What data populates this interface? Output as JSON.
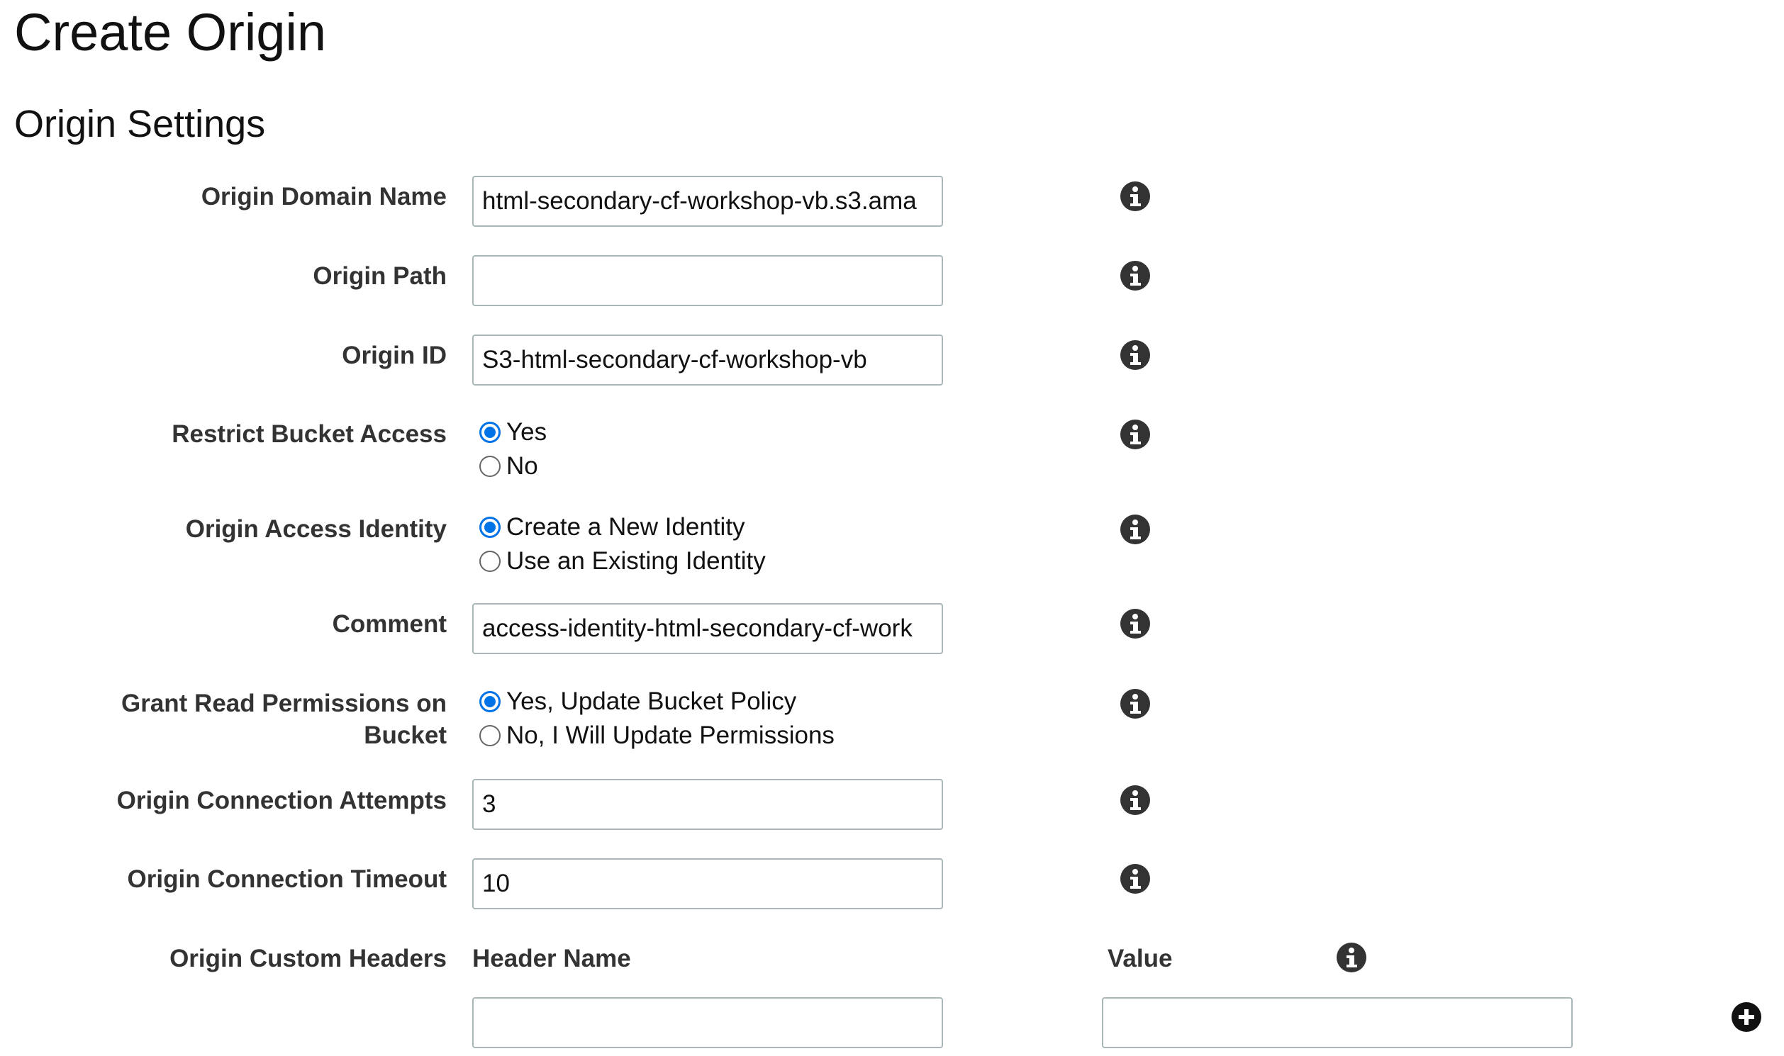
{
  "page": {
    "title": "Create Origin",
    "section_title": "Origin Settings"
  },
  "fields": {
    "origin_domain_name": {
      "label": "Origin Domain Name",
      "value": "html-secondary-cf-workshop-vb.s3.ama"
    },
    "origin_path": {
      "label": "Origin Path",
      "value": ""
    },
    "origin_id": {
      "label": "Origin ID",
      "value": "S3-html-secondary-cf-workshop-vb"
    },
    "restrict_bucket_access": {
      "label": "Restrict Bucket Access",
      "options": [
        {
          "label": "Yes",
          "selected": true
        },
        {
          "label": "No",
          "selected": false
        }
      ]
    },
    "origin_access_identity": {
      "label": "Origin Access Identity",
      "options": [
        {
          "label": "Create a New Identity",
          "selected": true
        },
        {
          "label": "Use an Existing Identity",
          "selected": false
        }
      ]
    },
    "comment": {
      "label": "Comment",
      "value": "access-identity-html-secondary-cf-work"
    },
    "grant_read_permissions": {
      "label_line1": "Grant Read Permissions on",
      "label_line2": "Bucket",
      "options": [
        {
          "label": "Yes, Update Bucket Policy",
          "selected": true
        },
        {
          "label": "No, I Will Update Permissions",
          "selected": false
        }
      ]
    },
    "origin_connection_attempts": {
      "label": "Origin Connection Attempts",
      "value": "3"
    },
    "origin_connection_timeout": {
      "label": "Origin Connection Timeout",
      "value": "10"
    },
    "origin_custom_headers": {
      "label": "Origin Custom Headers",
      "header_name_label": "Header Name",
      "value_label": "Value",
      "header_name_value": "",
      "value_value": ""
    }
  },
  "icons": {
    "info": "info-icon",
    "add": "plus-circle-icon"
  },
  "colors": {
    "radio_selected": "#0073e6",
    "input_border": "#aab7b8",
    "label_text": "#333333"
  }
}
